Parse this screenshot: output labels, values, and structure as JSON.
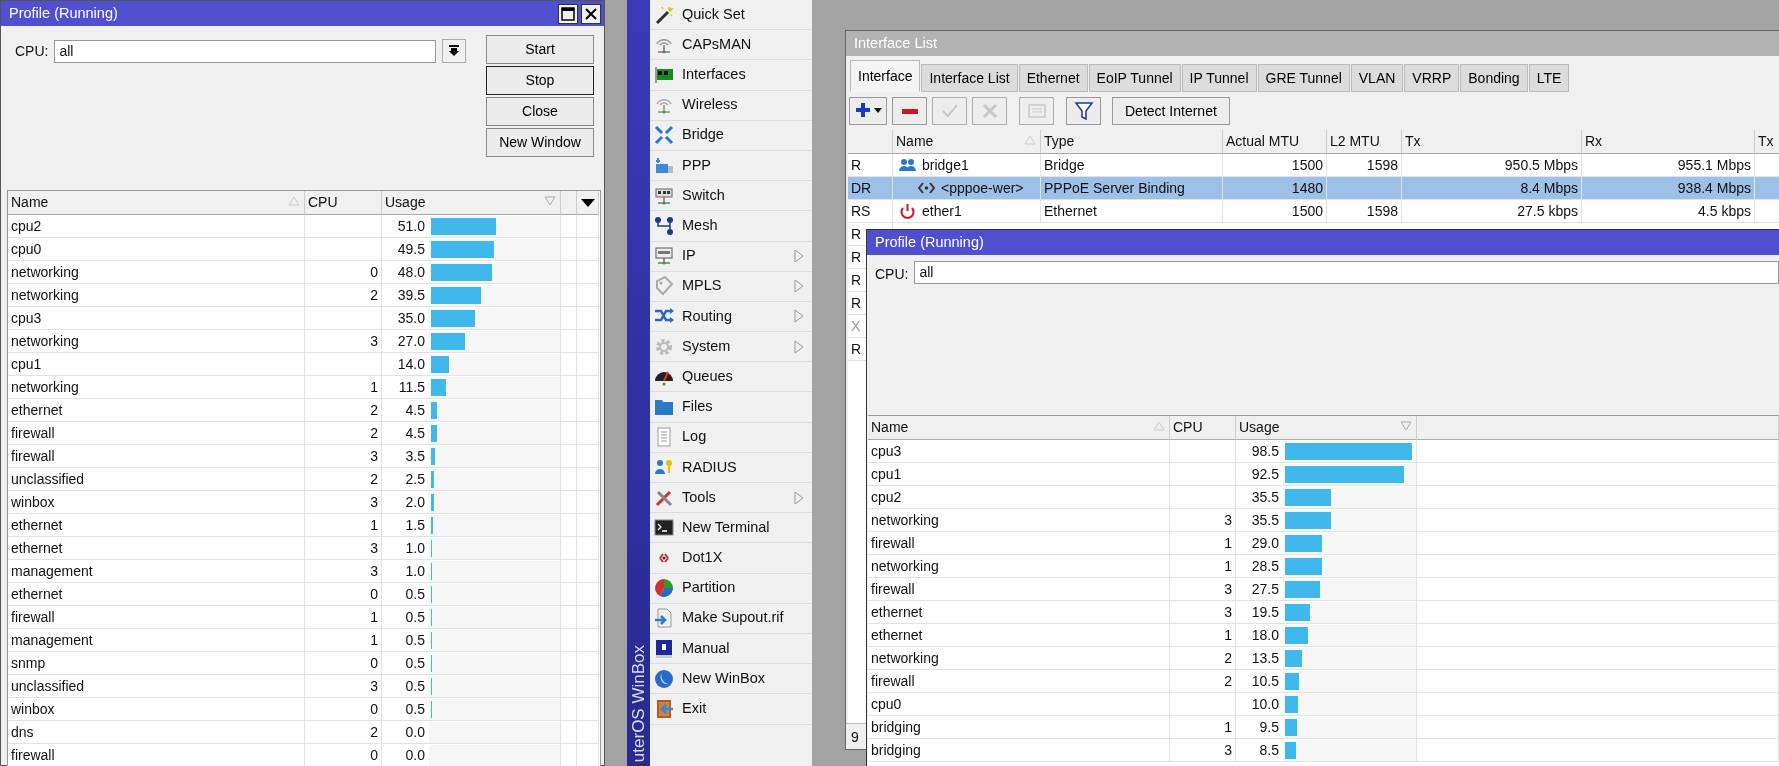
{
  "profile_window": {
    "title": "Profile (Running)",
    "cpu_label": "CPU:",
    "cpu_value": "all",
    "buttons": [
      {
        "label": "Start",
        "focused": false
      },
      {
        "label": "Stop",
        "focused": true
      },
      {
        "label": "Close",
        "focused": false
      },
      {
        "label": "New Window",
        "focused": false
      }
    ],
    "columns": [
      {
        "label": "Name",
        "sorted": true,
        "descending": false
      },
      {
        "label": "CPU",
        "sorted": false
      },
      {
        "label": "Usage",
        "sorted": true,
        "descending": true
      }
    ],
    "rows": [
      {
        "name": "cpu2",
        "cpu": "",
        "usage": "51.0",
        "level": 0.51
      },
      {
        "name": "cpu0",
        "cpu": "",
        "usage": "49.5",
        "level": 0.495
      },
      {
        "name": "networking",
        "cpu": "0",
        "usage": "48.0",
        "level": 0.48
      },
      {
        "name": "networking",
        "cpu": "2",
        "usage": "39.5",
        "level": 0.395
      },
      {
        "name": "cpu3",
        "cpu": "",
        "usage": "35.0",
        "level": 0.35
      },
      {
        "name": "networking",
        "cpu": "3",
        "usage": "27.0",
        "level": 0.27
      },
      {
        "name": "cpu1",
        "cpu": "",
        "usage": "14.0",
        "level": 0.14
      },
      {
        "name": "networking",
        "cpu": "1",
        "usage": "11.5",
        "level": 0.115
      },
      {
        "name": "ethernet",
        "cpu": "2",
        "usage": "4.5",
        "level": 0.045
      },
      {
        "name": "firewall",
        "cpu": "2",
        "usage": "4.5",
        "level": 0.045
      },
      {
        "name": "firewall",
        "cpu": "3",
        "usage": "3.5",
        "level": 0.035
      },
      {
        "name": "unclassified",
        "cpu": "2",
        "usage": "2.5",
        "level": 0.025
      },
      {
        "name": "winbox",
        "cpu": "3",
        "usage": "2.0",
        "level": 0.02
      },
      {
        "name": "ethernet",
        "cpu": "1",
        "usage": "1.5",
        "level": 0.015
      },
      {
        "name": "ethernet",
        "cpu": "3",
        "usage": "1.0",
        "level": 0.01
      },
      {
        "name": "management",
        "cpu": "3",
        "usage": "1.0",
        "level": 0.01
      },
      {
        "name": "ethernet",
        "cpu": "0",
        "usage": "0.5",
        "level": 0.005
      },
      {
        "name": "firewall",
        "cpu": "1",
        "usage": "0.5",
        "level": 0.005
      },
      {
        "name": "management",
        "cpu": "1",
        "usage": "0.5",
        "level": 0.005
      },
      {
        "name": "snmp",
        "cpu": "0",
        "usage": "0.5",
        "level": 0.005
      },
      {
        "name": "unclassified",
        "cpu": "3",
        "usage": "0.5",
        "level": 0.005
      },
      {
        "name": "winbox",
        "cpu": "0",
        "usage": "0.5",
        "level": 0.005
      },
      {
        "name": "dns",
        "cpu": "2",
        "usage": "0.0"
      },
      {
        "name": "firewall",
        "cpu": "0",
        "usage": "0.0"
      }
    ]
  },
  "menu": {
    "side_label": "uterOS WinBox",
    "items": [
      {
        "label": "Quick Set",
        "submenu": false
      },
      {
        "label": "CAPsMAN",
        "submenu": false
      },
      {
        "label": "Interfaces",
        "submenu": false
      },
      {
        "label": "Wireless",
        "submenu": false
      },
      {
        "label": "Bridge",
        "submenu": false
      },
      {
        "label": "PPP",
        "submenu": false
      },
      {
        "label": "Switch",
        "submenu": false
      },
      {
        "label": "Mesh",
        "submenu": false
      },
      {
        "label": "IP",
        "submenu": true
      },
      {
        "label": "MPLS",
        "submenu": true
      },
      {
        "label": "Routing",
        "submenu": true
      },
      {
        "label": "System",
        "submenu": true
      },
      {
        "label": "Queues",
        "submenu": false
      },
      {
        "label": "Files",
        "submenu": false
      },
      {
        "label": "Log",
        "submenu": false
      },
      {
        "label": "RADIUS",
        "submenu": false
      },
      {
        "label": "Tools",
        "submenu": true
      },
      {
        "label": "New Terminal",
        "submenu": false
      },
      {
        "label": "Dot1X",
        "submenu": false
      },
      {
        "label": "Partition",
        "submenu": false
      },
      {
        "label": "Make Supout.rif",
        "submenu": false
      },
      {
        "label": "Manual",
        "submenu": false
      },
      {
        "label": "New WinBox",
        "submenu": false
      },
      {
        "label": "Exit",
        "submenu": false
      }
    ]
  },
  "interface_window": {
    "title": "Interface List",
    "tabs": [
      {
        "label": "Interface",
        "selected": true
      },
      {
        "label": "Interface List",
        "selected": false
      },
      {
        "label": "Ethernet",
        "selected": false
      },
      {
        "label": "EoIP Tunnel",
        "selected": false
      },
      {
        "label": "IP Tunnel",
        "selected": false
      },
      {
        "label": "GRE Tunnel",
        "selected": false
      },
      {
        "label": "VLAN",
        "selected": false
      },
      {
        "label": "VRRP",
        "selected": false
      },
      {
        "label": "Bonding",
        "selected": false
      },
      {
        "label": "LTE",
        "selected": false
      }
    ],
    "toolbar": [
      {
        "kind": "add",
        "disabled": false
      },
      {
        "kind": "remove",
        "disabled": false
      },
      {
        "kind": "enable",
        "disabled": true
      },
      {
        "kind": "disable",
        "disabled": true
      },
      {
        "kind": "comment",
        "disabled": true
      },
      {
        "kind": "filter",
        "disabled": false
      }
    ],
    "detect_button": "Detect Internet",
    "columns": [
      {
        "label": "Name",
        "sorted": true,
        "descending": false
      },
      {
        "label": "Type",
        "sorted": false
      },
      {
        "label": "Actual MTU",
        "sorted": false
      },
      {
        "label": "L2 MTU",
        "sorted": false
      },
      {
        "label": "Tx",
        "sorted": false
      },
      {
        "label": "Rx",
        "sorted": false
      },
      {
        "label": "Tx",
        "sorted": false
      }
    ],
    "rows": [
      {
        "flags": "R",
        "kind": "bridge",
        "name": "bridge1",
        "type": "Bridge",
        "actual_mtu": "1500",
        "l2_mtu": "1598",
        "tx": "950.5 Mbps",
        "rx": "955.1 Mbps",
        "selected": false,
        "disabled": false
      },
      {
        "flags": "DR",
        "kind": "pppoe",
        "name": "<pppoe-wer>",
        "type": "PPPoE Server Binding",
        "actual_mtu": "1480",
        "l2_mtu": "",
        "tx": "8.4 Mbps",
        "rx": "938.4 Mbps",
        "selected": true,
        "disabled": false
      },
      {
        "flags": "RS",
        "kind": "ethernet",
        "name": "ether1",
        "type": "Ethernet",
        "actual_mtu": "1500",
        "l2_mtu": "1598",
        "tx": "27.5 kbps",
        "rx": "4.5 kbps",
        "selected": false,
        "disabled": false
      },
      {
        "flags": "R",
        "selected": false,
        "disabled": false
      },
      {
        "flags": "R",
        "selected": false,
        "disabled": false
      },
      {
        "flags": "R",
        "selected": false,
        "disabled": false
      },
      {
        "flags": "R",
        "selected": false,
        "disabled": false
      },
      {
        "flags": "X",
        "selected": false,
        "disabled": true
      },
      {
        "flags": "R",
        "selected": false,
        "disabled": false
      }
    ],
    "status": "9"
  },
  "profile_window_2": {
    "title": "Profile (Running)",
    "cpu_label": "CPU:",
    "cpu_value": "all",
    "columns": [
      {
        "label": "Name",
        "sorted": true,
        "descending": false
      },
      {
        "label": "CPU",
        "sorted": false
      },
      {
        "label": "Usage",
        "sorted": true,
        "descending": true
      }
    ],
    "rows": [
      {
        "name": "cpu3",
        "cpu": "",
        "usage": "98.5",
        "level": 0.985
      },
      {
        "name": "cpu1",
        "cpu": "",
        "usage": "92.5",
        "level": 0.925
      },
      {
        "name": "cpu2",
        "cpu": "",
        "usage": "35.5",
        "level": 0.355
      },
      {
        "name": "networking",
        "cpu": "3",
        "usage": "35.5",
        "level": 0.355
      },
      {
        "name": "firewall",
        "cpu": "1",
        "usage": "29.0",
        "level": 0.29
      },
      {
        "name": "networking",
        "cpu": "1",
        "usage": "28.5",
        "level": 0.285
      },
      {
        "name": "firewall",
        "cpu": "3",
        "usage": "27.5",
        "level": 0.275
      },
      {
        "name": "ethernet",
        "cpu": "3",
        "usage": "19.5",
        "level": 0.195
      },
      {
        "name": "ethernet",
        "cpu": "1",
        "usage": "18.0",
        "level": 0.18
      },
      {
        "name": "networking",
        "cpu": "2",
        "usage": "13.5",
        "level": 0.135
      },
      {
        "name": "firewall",
        "cpu": "2",
        "usage": "10.5",
        "level": 0.105
      },
      {
        "name": "cpu0",
        "cpu": "",
        "usage": "10.0",
        "level": 0.1
      },
      {
        "name": "bridging",
        "cpu": "1",
        "usage": "9.5",
        "level": 0.095
      },
      {
        "name": "bridging",
        "cpu": "3",
        "usage": "8.5",
        "level": 0.085
      }
    ]
  }
}
